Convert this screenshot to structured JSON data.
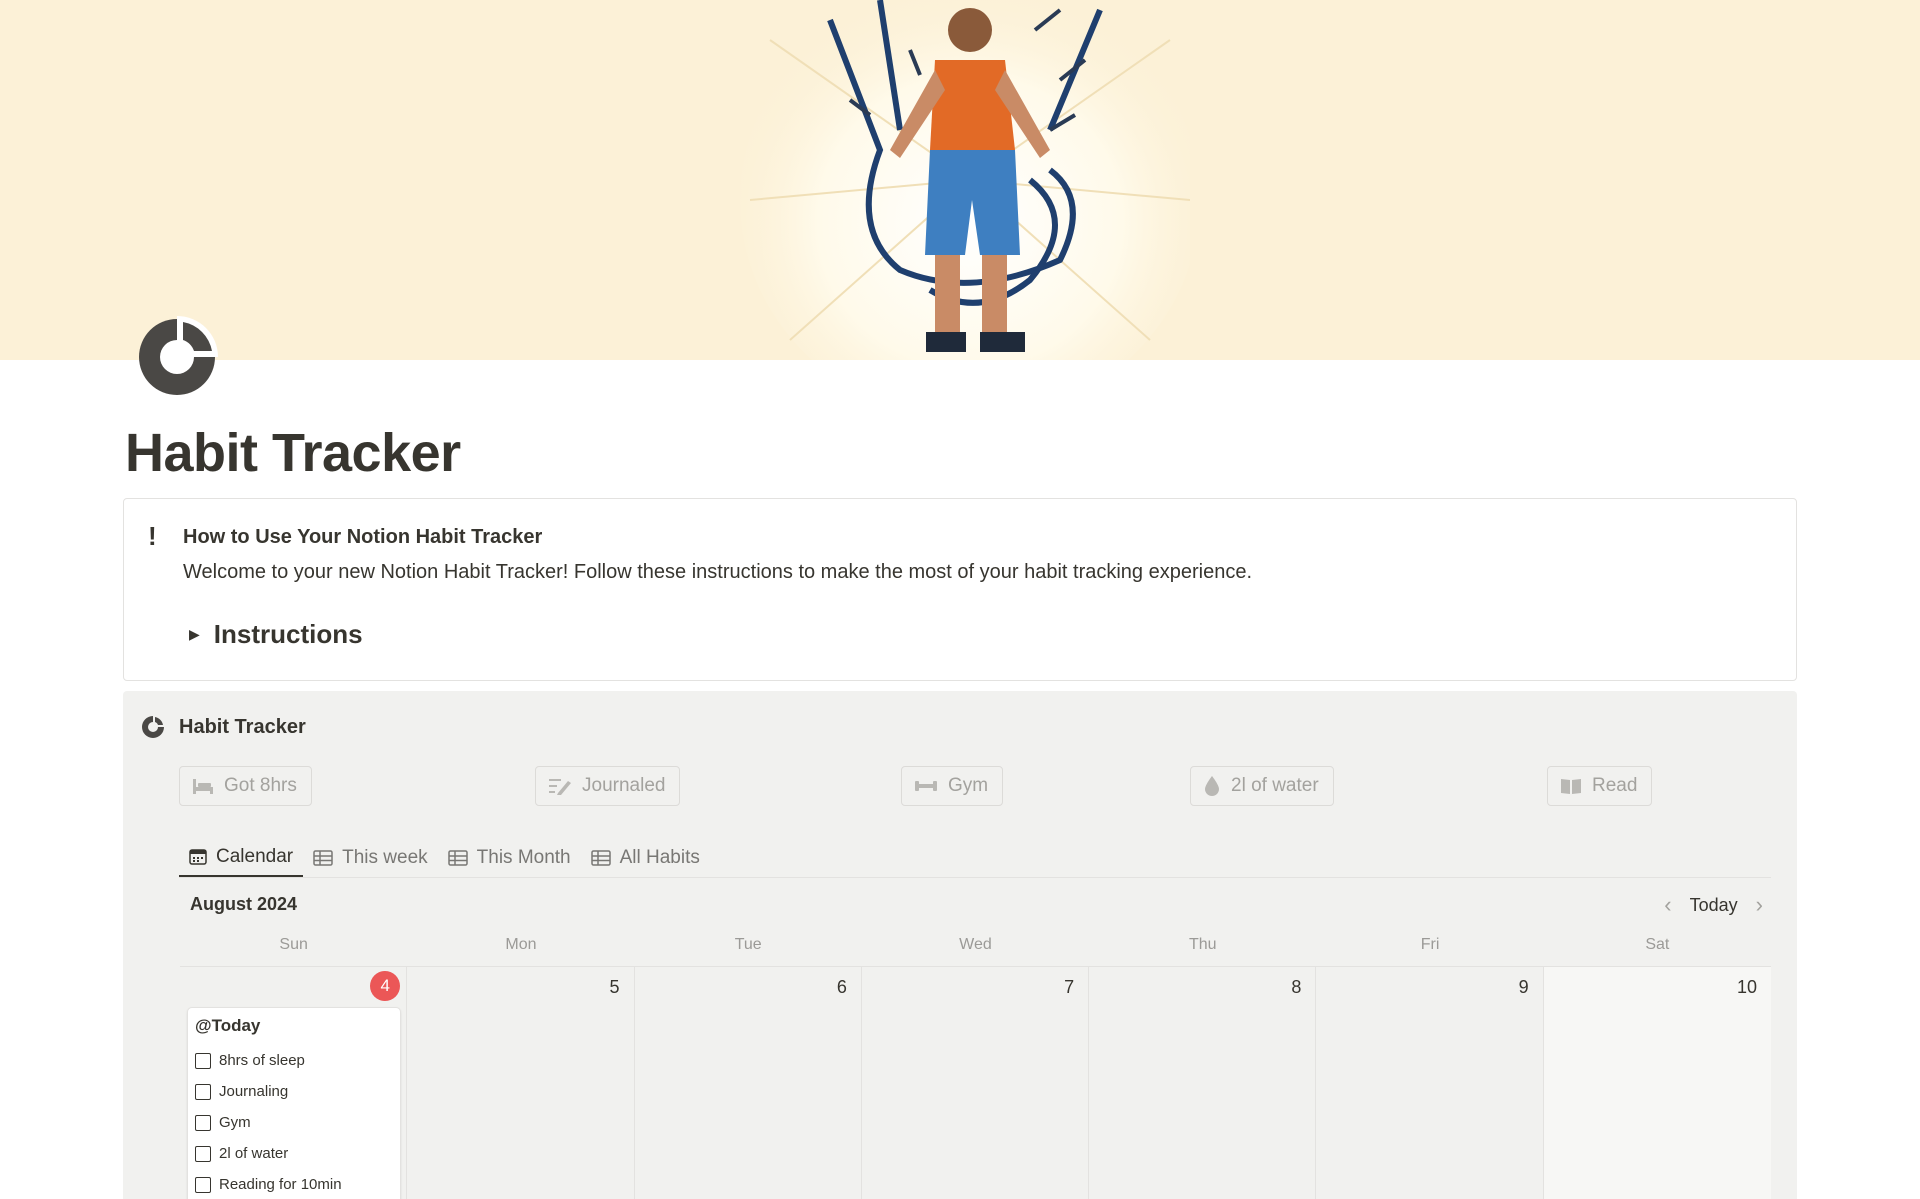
{
  "page": {
    "title": "Habit Tracker"
  },
  "callout": {
    "icon": "!",
    "title": "How to Use Your Notion Habit Tracker",
    "body": "Welcome to your new Notion Habit Tracker! Follow these instructions to make the most of your habit tracking experience.",
    "toggle_label": "Instructions"
  },
  "database": {
    "title": "Habit Tracker",
    "habit_buttons": [
      {
        "label": "Got 8hrs",
        "icon": "bed-icon"
      },
      {
        "label": "Journaled",
        "icon": "journal-icon"
      },
      {
        "label": "Gym",
        "icon": "dumbbell-icon"
      },
      {
        "label": "2l of water",
        "icon": "water-drop-icon"
      },
      {
        "label": "Read",
        "icon": "book-icon"
      }
    ],
    "tabs": [
      {
        "label": "Calendar",
        "icon": "calendar-icon",
        "active": true
      },
      {
        "label": "This week",
        "icon": "table-icon",
        "active": false
      },
      {
        "label": "This Month",
        "icon": "table-icon",
        "active": false
      },
      {
        "label": "All Habits",
        "icon": "table-icon",
        "active": false
      }
    ]
  },
  "calendar": {
    "month_label": "August 2024",
    "today_label": "Today",
    "weekdays": [
      "Sun",
      "Mon",
      "Tue",
      "Wed",
      "Thu",
      "Fri",
      "Sat"
    ],
    "days": [
      "4",
      "5",
      "6",
      "7",
      "8",
      "9",
      "10"
    ],
    "today_index": 0,
    "card": {
      "title": "@Today",
      "items": [
        "8hrs of sleep",
        "Journaling",
        "Gym",
        "2l of water",
        "Reading for 10min"
      ]
    }
  },
  "colors": {
    "cover_bg": "#fcf1d7",
    "db_bg": "#f1f1ef",
    "today_badge": "#eb5757",
    "text": "#37352f"
  }
}
